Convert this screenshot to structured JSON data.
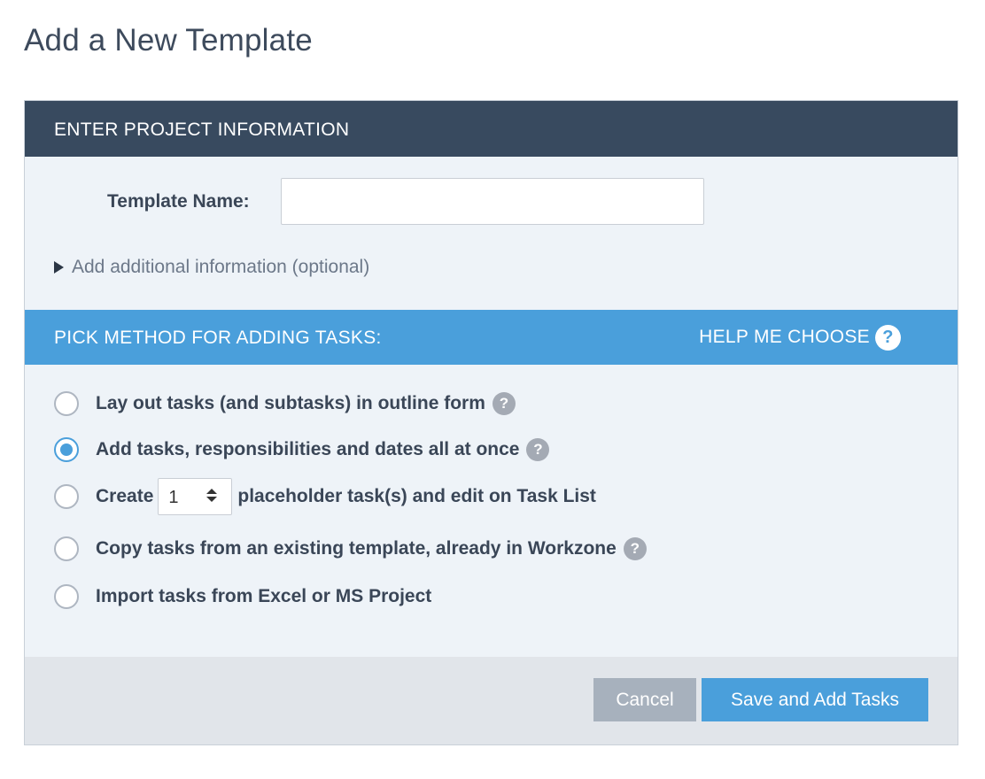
{
  "page": {
    "title": "Add a New Template"
  },
  "project_section": {
    "heading": "ENTER PROJECT INFORMATION",
    "template_name_label": "Template Name:",
    "template_name_value": "",
    "additional_info_link": "Add additional information (optional)"
  },
  "tasks_section": {
    "heading": "PICK METHOD FOR ADDING TASKS:",
    "help_link": "HELP ME CHOOSE",
    "help_icon_glyph": "?",
    "options": [
      {
        "label": "Lay out tasks (and subtasks) in outline form",
        "checked": false,
        "has_help": true
      },
      {
        "label": "Add tasks, responsibilities and dates all at once",
        "checked": true,
        "has_help": true
      },
      {
        "label_before": "Create",
        "stepper_value": "1",
        "label_after": "placeholder task(s) and edit on Task List",
        "checked": false,
        "has_help": false
      },
      {
        "label": "Copy tasks from an existing template, already in Workzone",
        "checked": false,
        "has_help": true
      },
      {
        "label": "Import tasks from Excel or MS Project",
        "checked": false,
        "has_help": false
      }
    ]
  },
  "footer": {
    "cancel_label": "Cancel",
    "save_label": "Save and Add Tasks"
  },
  "colors": {
    "header_dark": "#384a5f",
    "header_blue": "#4a9fdb",
    "panel_bg": "#eef3f8",
    "footer_bg": "#e1e5ea",
    "cancel_btn": "#a7b1bd",
    "primary_btn": "#4a9fdb"
  },
  "icons": {
    "expand": "triangle-right-icon",
    "help": "question-circle-icon",
    "stepper": "up-down-arrows-icon"
  }
}
